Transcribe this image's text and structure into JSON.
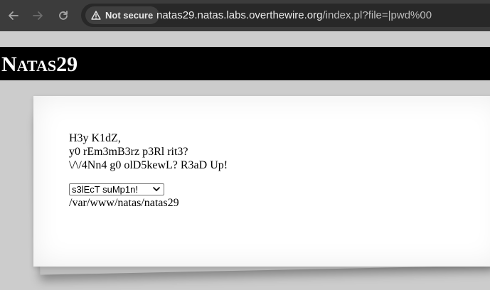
{
  "browser": {
    "security_label": "Not secure",
    "url_host": "natas29.natas.labs.overthewire.org",
    "url_rest": "/index.pl?file=|pwd%00"
  },
  "header": {
    "title_big": "N",
    "title_rest": "ATAS",
    "title_num": "29"
  },
  "content": {
    "lines": [
      "H3y K1dZ,",
      "y0 rEm3mB3rz p3Rl rit3?",
      "\\/\\/4Nn4 g0 olD5kewL? R3aD Up!"
    ],
    "select_value": "s3lEcT suMp1n!",
    "path_output": "/var/www/natas/natas29"
  }
}
